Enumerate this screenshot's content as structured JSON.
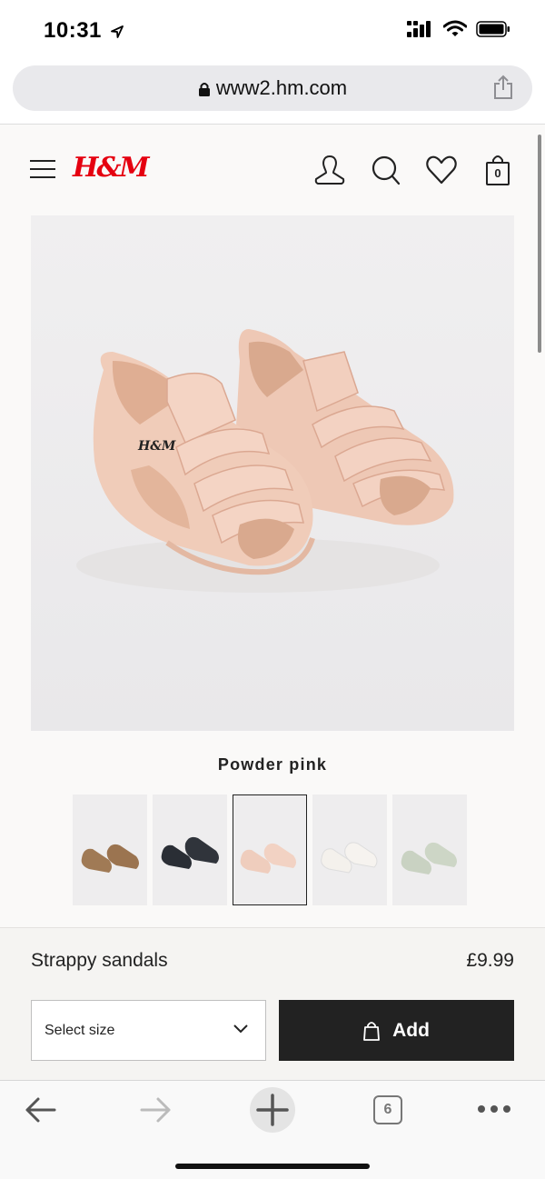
{
  "status_bar": {
    "time": "10:31",
    "icons": [
      "location-arrow-icon",
      "signal-icon",
      "wifi-icon",
      "battery-icon"
    ]
  },
  "browser": {
    "url": "www2.hm.com",
    "tab_count": "6",
    "icons": [
      "lock-icon",
      "share-icon",
      "back-arrow-icon",
      "forward-arrow-icon",
      "new-tab-plus-icon",
      "tabs-icon",
      "more-dots-icon"
    ]
  },
  "site_header": {
    "logo": "H&M",
    "icons": [
      "hamburger-menu-icon",
      "account-icon",
      "search-icon",
      "favourites-heart-icon",
      "shopping-bag-icon"
    ],
    "bag_count": "0"
  },
  "product": {
    "color_name": "Powder pink",
    "swatches": [
      {
        "name": "Brown",
        "color": "#a07a55"
      },
      {
        "name": "Black",
        "color": "#2a2e35"
      },
      {
        "name": "Powder pink",
        "color": "#efcdbd",
        "selected": true
      },
      {
        "name": "White",
        "color": "#f4f1ec"
      },
      {
        "name": "Sage green",
        "color": "#c9d2c2"
      }
    ],
    "name": "Strappy sandals",
    "price": "£9.99",
    "size_select_label": "Select size",
    "add_button_label": "Add"
  },
  "colors": {
    "brand_red": "#e50010",
    "button_dark": "#222222",
    "sandal_pink": "#efcdbd"
  }
}
